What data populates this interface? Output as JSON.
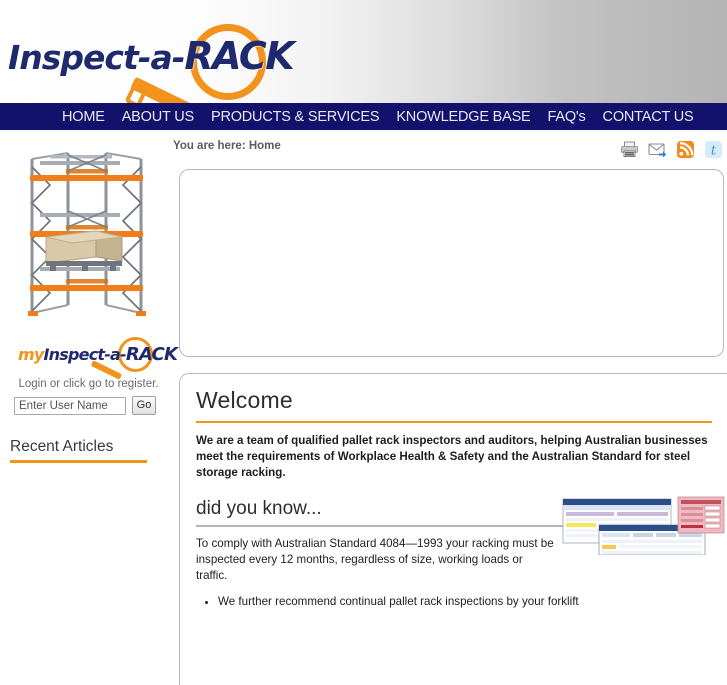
{
  "brand": {
    "logo_prefix": "Inspect-a-",
    "logo_suffix": "RACK",
    "accent_color": "#f2931e",
    "navy_color": "#12116b"
  },
  "nav": {
    "items": [
      {
        "label": "HOME"
      },
      {
        "label": "ABOUT US"
      },
      {
        "label": "PRODUCTS & SERVICES"
      },
      {
        "label": "KNOWLEDGE BASE"
      },
      {
        "label": "FAQ's"
      },
      {
        "label": "CONTACT US"
      }
    ]
  },
  "breadcrumb": {
    "text": "You are here: Home"
  },
  "utility_icons": [
    {
      "name": "print-icon"
    },
    {
      "name": "email-icon"
    },
    {
      "name": "rss-icon"
    },
    {
      "name": "twitter-icon"
    }
  ],
  "sidebar": {
    "rack_image_alt": "pallet racking illustration",
    "member_logo": {
      "my": "my",
      "prefix": "Inspect-a-",
      "suffix": "RACK"
    },
    "login_note": "Login or click go to register.",
    "username_placeholder": "Enter User Name",
    "username_value": "",
    "go_label": "Go",
    "recent_articles_title": "Recent Articles"
  },
  "main": {
    "welcome": {
      "heading": "Welcome",
      "lead": "We are a team of qualified pallet rack inspectors and auditors, helping Australian businesses meet the requirements of Workplace Health & Safety and the Australian Standard for steel storage racking."
    },
    "did_you_know": {
      "heading": "did you know...",
      "body": "To comply with Australian Standard 4084—1993 your racking must be inspected every 12 months, regardless of size, working loads or traffic.",
      "bullet": "We further recommend continual pallet rack inspections by your forklift"
    },
    "screenshots_alt": "inspection software screenshots"
  }
}
